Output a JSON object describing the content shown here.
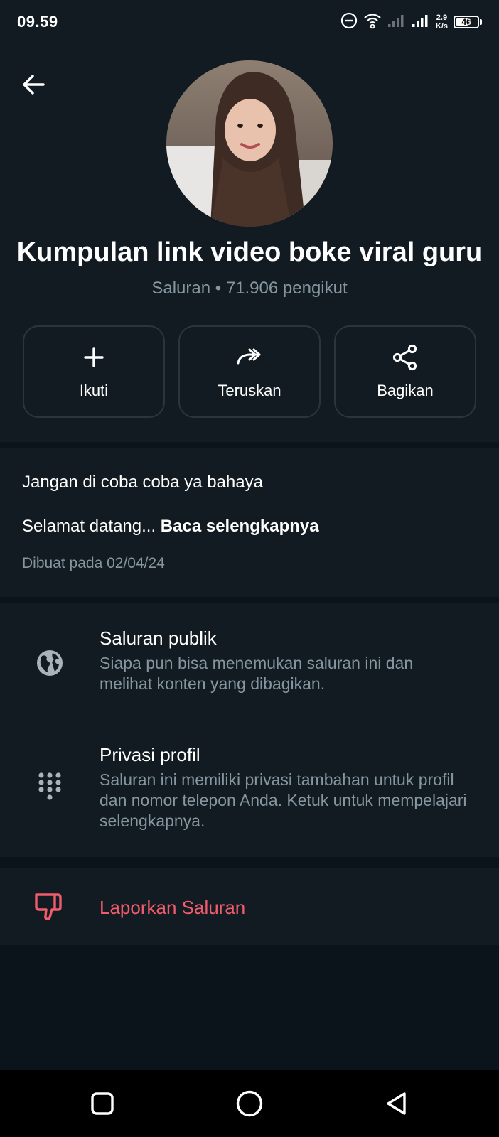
{
  "status_bar": {
    "time": "09.59",
    "net_speed_value": "2.9",
    "net_speed_unit": "K/s",
    "battery_level": "46"
  },
  "header": {
    "title": "Kumpulan link video boke viral guru",
    "subtitle": "Saluran • 71.906 pengikut"
  },
  "actions": [
    {
      "label": "Ikuti",
      "icon": "plus-icon"
    },
    {
      "label": "Teruskan",
      "icon": "forward-icon"
    },
    {
      "label": "Bagikan",
      "icon": "share-icon"
    }
  ],
  "description": {
    "line1": "Jangan di coba coba ya bahaya",
    "line2_text": "Selamat datang... ",
    "read_more": "Baca selengkapnya",
    "created": "Dibuat pada 02/04/24"
  },
  "info": [
    {
      "icon": "globe-icon",
      "title": "Saluran publik",
      "desc": "Siapa pun bisa menemukan saluran ini dan melihat konten yang dibagikan."
    },
    {
      "icon": "dialpad-icon",
      "title": "Privasi profil",
      "desc": "Saluran ini memiliki privasi tambahan untuk profil dan nomor telepon Anda. Ketuk untuk mempelajari selengkapnya."
    }
  ],
  "report": {
    "label": "Laporkan Saluran",
    "icon": "thumbs-down-icon"
  },
  "colors": {
    "background": "#0b141a",
    "surface": "#111b21",
    "secondary_text": "#8696a0",
    "danger": "#f15c6d"
  }
}
